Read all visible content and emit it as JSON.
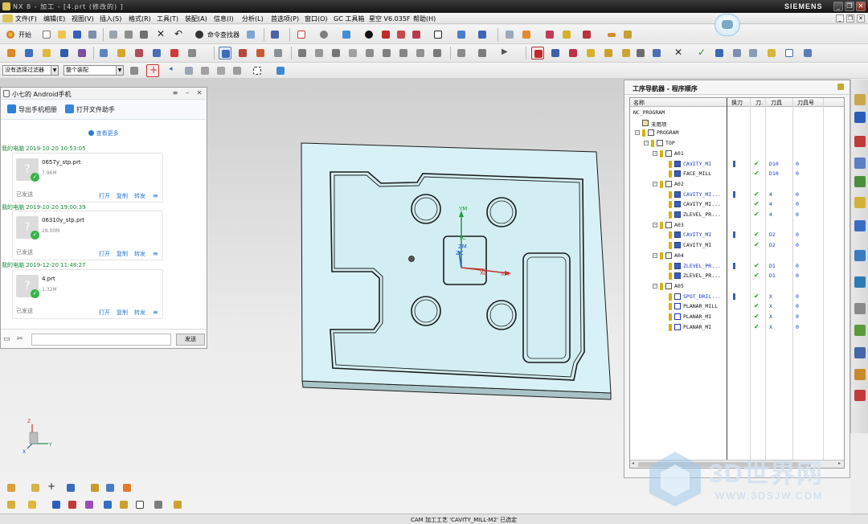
{
  "window": {
    "title": "NX 8 - 加工 - [4.prt (修改的) ]",
    "brand": "SIEMENS",
    "controls": [
      "_",
      "❐",
      "✕"
    ]
  },
  "menu": [
    "文件(F)",
    "编辑(E)",
    "视图(V)",
    "插入(S)",
    "格式(R)",
    "工具(T)",
    "装配(A)",
    "信息(I)",
    "分析(L)",
    "首选项(P)",
    "窗口(O)",
    "GC 工具箱",
    "星空 V6.035F",
    "帮助(H)"
  ],
  "toolbar": {
    "start_label": "开始",
    "command_finder_label": "命令查找器"
  },
  "selection": {
    "filter_value": "没有选择过滤器",
    "scope_value": "整个装配"
  },
  "phone_panel": {
    "title": "小七的 Android手机",
    "tabs": [
      "导出手机相册",
      "打开文件助手"
    ],
    "see_more": "查看更多",
    "messages": [
      {
        "header": "我的电脑 2019-10-20 10:53:05",
        "file": "0657y_stp.prt",
        "size": "7.96M",
        "state": "已发送",
        "actions": [
          "打开",
          "复制",
          "转发"
        ]
      },
      {
        "header": "我的电脑 2019-10-20 19:00:39",
        "file": "06310y_stp.prt",
        "size": "28.00M",
        "state": "已发送",
        "actions": [
          "打开",
          "复制",
          "转发"
        ]
      },
      {
        "header": "我的电脑 2019-12-20 11:48:27",
        "file": "4.prt",
        "size": "1.32M",
        "state": "已发送",
        "actions": [
          "打开",
          "复制",
          "转发"
        ]
      }
    ],
    "send_label": "发送"
  },
  "viewport": {
    "csys": {
      "ym": "YM",
      "yc": "YC",
      "zm": "ZM",
      "zc": "ZC",
      "xc": "XC",
      "xm": "XM"
    },
    "triad": {
      "x": "X",
      "y": "Y",
      "z": "Z"
    }
  },
  "navigator": {
    "title": "工序导航器 - 程序顺序",
    "columns": [
      "名称",
      "换刀",
      "刀.",
      "刀具",
      "刀具号"
    ],
    "rows": [
      {
        "depth": 0,
        "kind": "root",
        "name": "NC_PROGRAM"
      },
      {
        "depth": 1,
        "kind": "folder",
        "name": "未用项"
      },
      {
        "depth": 1,
        "kind": "program",
        "name": "PROGRAM",
        "expand": "⊟"
      },
      {
        "depth": 2,
        "kind": "program",
        "name": "TOP",
        "expand": "⊟"
      },
      {
        "depth": 3,
        "kind": "program",
        "name": "A01",
        "expand": "⊟"
      },
      {
        "depth": 4,
        "kind": "op",
        "name": "CAVITY_MI",
        "highlight": true,
        "path": true,
        "tool": "D10",
        "num": "0"
      },
      {
        "depth": 4,
        "kind": "op",
        "name": "FACE_MILL",
        "tool": "D10",
        "num": "0"
      },
      {
        "depth": 3,
        "kind": "program",
        "name": "A02",
        "expand": "⊟"
      },
      {
        "depth": 4,
        "kind": "op",
        "name": "CAVITY_MI...",
        "highlight": true,
        "path": true,
        "tool": "4",
        "num": "0"
      },
      {
        "depth": 4,
        "kind": "op",
        "name": "CAVITY_MI...",
        "tool": "4",
        "num": "0"
      },
      {
        "depth": 4,
        "kind": "op",
        "name": "ZLEVEL_PR...",
        "tool": "4",
        "num": "0"
      },
      {
        "depth": 3,
        "kind": "program",
        "name": "A03",
        "expand": "⊟"
      },
      {
        "depth": 4,
        "kind": "op",
        "name": "CAVITY_MI",
        "highlight": true,
        "path": true,
        "tool": "D2",
        "num": "0"
      },
      {
        "depth": 4,
        "kind": "op",
        "name": "CAVITY_MI",
        "tool": "D2",
        "num": "0"
      },
      {
        "depth": 3,
        "kind": "program",
        "name": "A04",
        "expand": "⊟"
      },
      {
        "depth": 4,
        "kind": "op",
        "name": "ZLEVEL_PR...",
        "highlight": true,
        "path": true,
        "tool": "D1",
        "num": "0"
      },
      {
        "depth": 4,
        "kind": "op",
        "name": "ZLEVEL_PR...",
        "tool": "D1",
        "num": "0"
      },
      {
        "depth": 3,
        "kind": "program",
        "name": "A05",
        "expand": "⊟"
      },
      {
        "depth": 4,
        "kind": "op-drill",
        "name": "SPOT_DRIL...",
        "highlight": true,
        "path": true,
        "tool": "X",
        "num": "0"
      },
      {
        "depth": 4,
        "kind": "op-planar",
        "name": "PLANAR_MILL",
        "tool": "X",
        "num": "0"
      },
      {
        "depth": 4,
        "kind": "op-planar",
        "name": "PLANAR_MI",
        "tool": "X",
        "num": "0"
      },
      {
        "depth": 4,
        "kind": "op-planar",
        "name": "PLANAR_MI",
        "tool": "X",
        "num": "0"
      }
    ]
  },
  "status": {
    "message": "CAM 加工工艺 'CAVITY_MILL-M2' 已选定"
  },
  "watermark": {
    "title": "3D世界网",
    "url": "WWW.3DSJW.COM"
  },
  "colors": {
    "part_face": "#d8f1f6",
    "part_edge": "#1c1c1c",
    "check_green": "#1ea21e",
    "op_blue": "#1b36c8",
    "siemens_bar": "#1a1a1a"
  }
}
